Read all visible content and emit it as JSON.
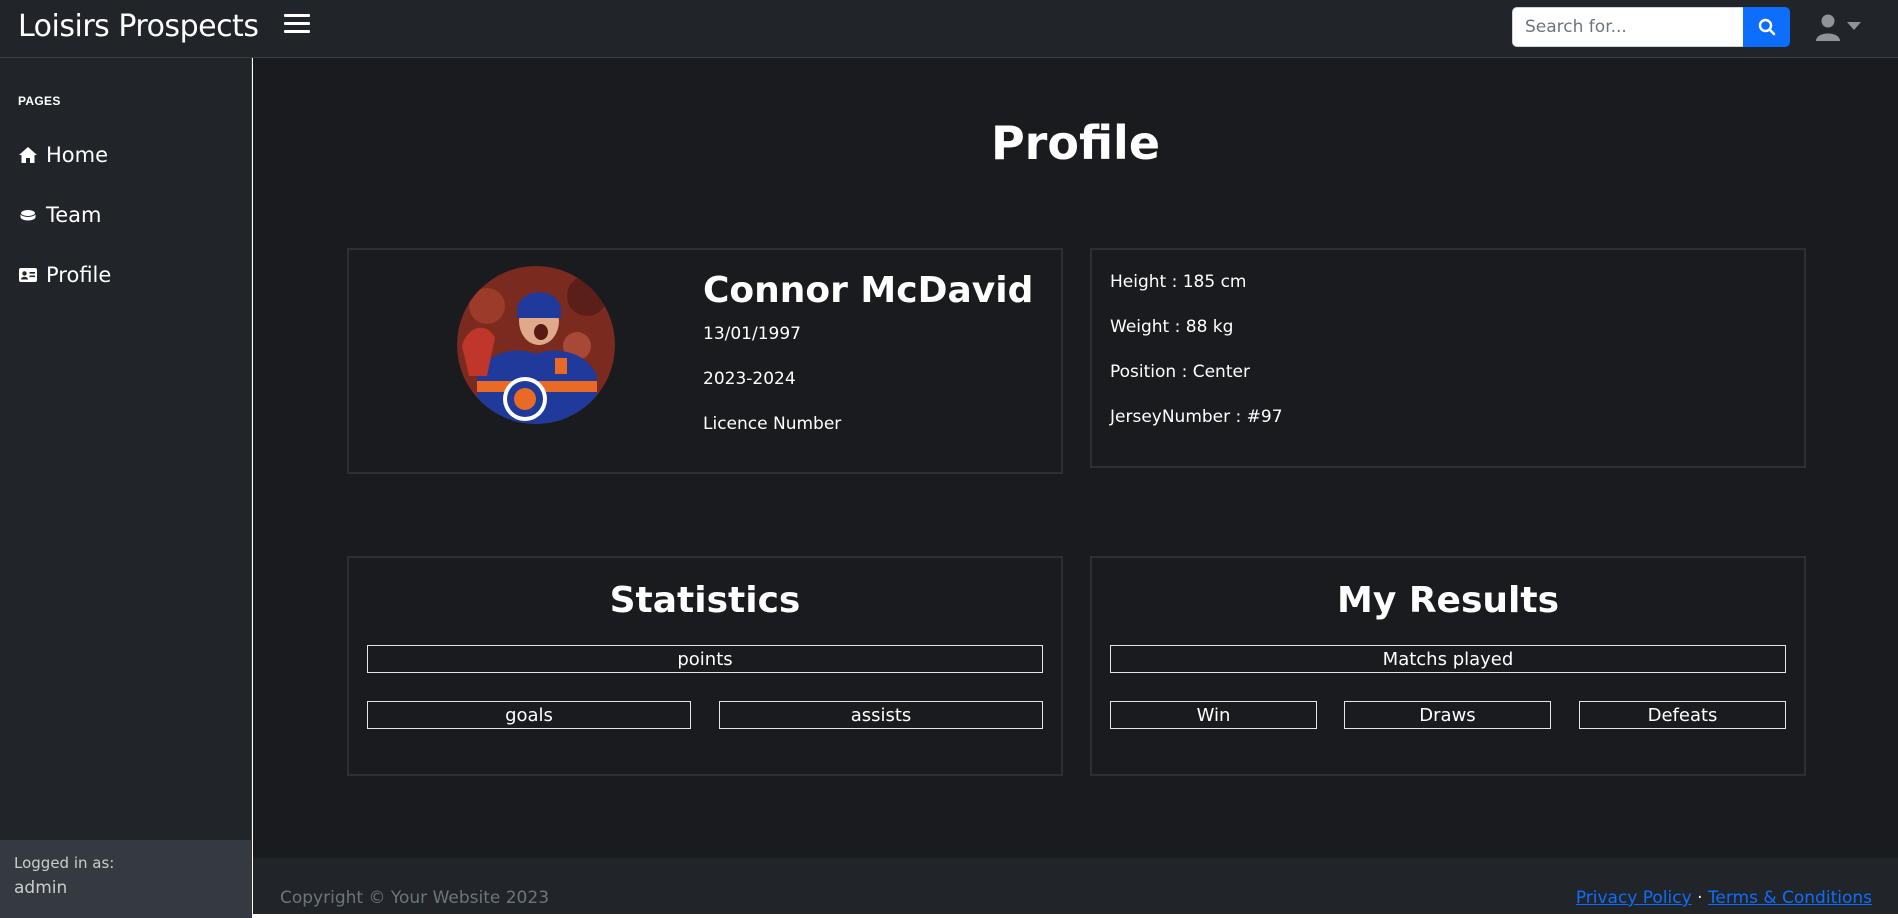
{
  "header": {
    "brand": "Loisirs Prospects",
    "search_placeholder": "Search for...",
    "accent_color": "#0d6efd"
  },
  "sidebar": {
    "heading": "PAGES",
    "items": [
      {
        "label": "Home",
        "icon": "home-icon"
      },
      {
        "label": "Team",
        "icon": "hockey-puck-icon"
      },
      {
        "label": "Profile",
        "icon": "id-card-icon"
      }
    ],
    "footer": {
      "label": "Logged in as:",
      "user": "admin"
    }
  },
  "main": {
    "title": "Profile",
    "profile": {
      "name": "Connor McDavid",
      "birthdate": "13/01/1997",
      "season": "2023-2024",
      "licence": "Licence Number"
    },
    "details": [
      "Height : 185 cm",
      "Weight : 88 kg",
      "Position : Center",
      "JerseyNumber : #97"
    ],
    "statistics": {
      "title": "Statistics",
      "points": "points",
      "goals": "goals",
      "assists": "assists"
    },
    "results": {
      "title": "My Results",
      "matches": "Matchs played",
      "win": "Win",
      "draws": "Draws",
      "defeats": "Defeats"
    }
  },
  "footer": {
    "copyright": "Copyright © Your Website 2023",
    "privacy": "Privacy Policy",
    "separator": "·",
    "terms": "Terms & Conditions"
  }
}
